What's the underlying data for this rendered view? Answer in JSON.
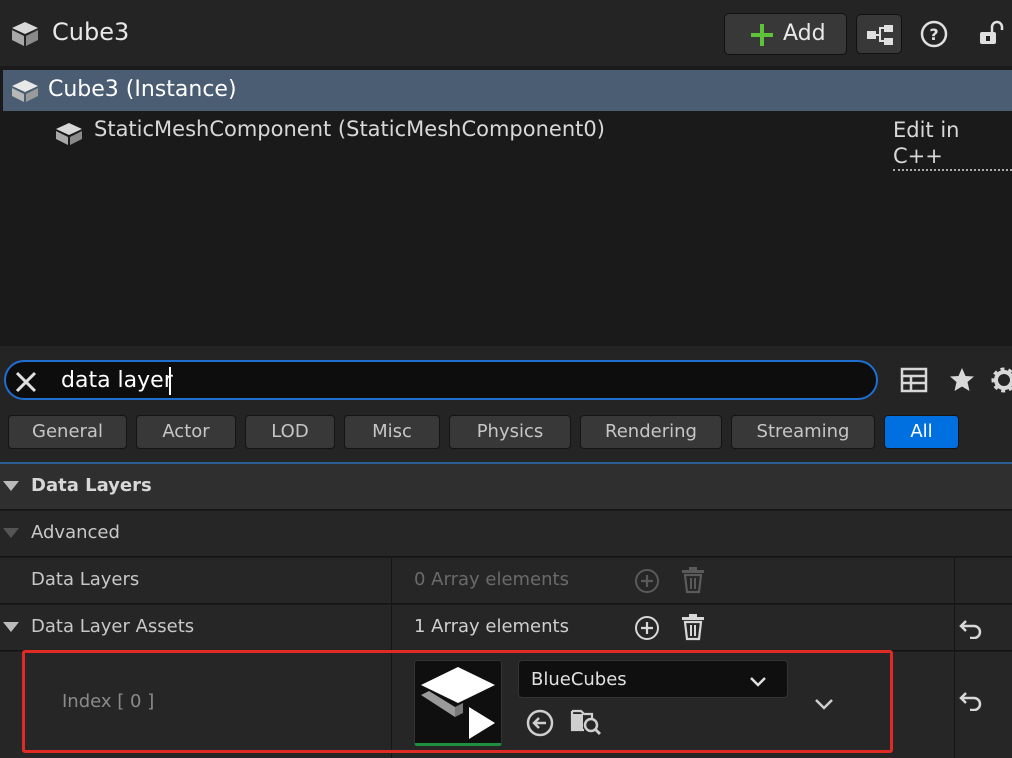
{
  "header": {
    "title": "Cube3",
    "add_label": "Add"
  },
  "tree": {
    "selected_label": "Cube3 (Instance)",
    "component_label": "StaticMeshComponent (StaticMeshComponent0)",
    "edit_link": "Edit in C++"
  },
  "search": {
    "value": "data layer"
  },
  "categories": [
    "General",
    "Actor",
    "LOD",
    "Misc",
    "Physics",
    "Rendering",
    "Streaming",
    "All"
  ],
  "active_category": "All",
  "details": {
    "section_label": "Data Layers",
    "advanced_label": "Advanced",
    "data_layers_label": "Data Layers",
    "data_layers_value": "0 Array elements",
    "data_layer_assets_label": "Data Layer Assets",
    "data_layer_assets_value": "1 Array elements",
    "index_label": "Index [ 0 ]",
    "asset_name": "BlueCubes"
  },
  "colors": {
    "accent": "#0070e0",
    "selection": "#4b5d73",
    "highlight": "#e02a26",
    "add_green": "#5ec23a"
  }
}
